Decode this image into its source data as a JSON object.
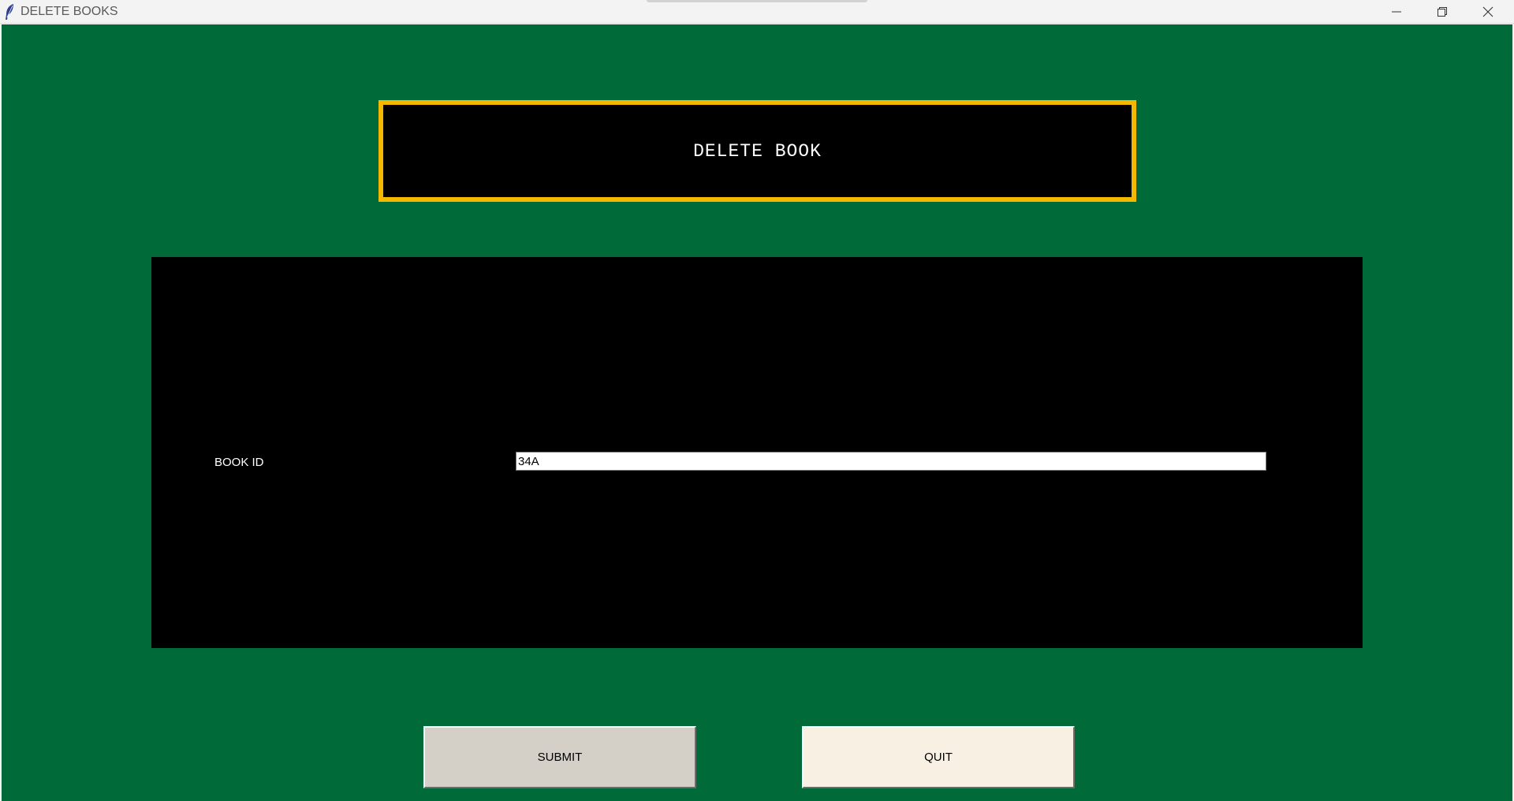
{
  "window": {
    "title": "DELETE BOOKS"
  },
  "heading": {
    "text": "DELETE BOOK"
  },
  "form": {
    "book_id_label": "BOOK ID",
    "book_id_value": "34A"
  },
  "buttons": {
    "submit_label": "SUBMIT",
    "quit_label": "QUIT"
  },
  "colors": {
    "background": "#006b38",
    "panel": "#000000",
    "heading_border": "#f5b800",
    "submit_bg": "#d4d0c8",
    "quit_bg": "#f8f0e2"
  },
  "icons": {
    "app": "feather-icon",
    "minimize": "minimize-icon",
    "restore": "restore-icon",
    "close": "close-icon"
  }
}
